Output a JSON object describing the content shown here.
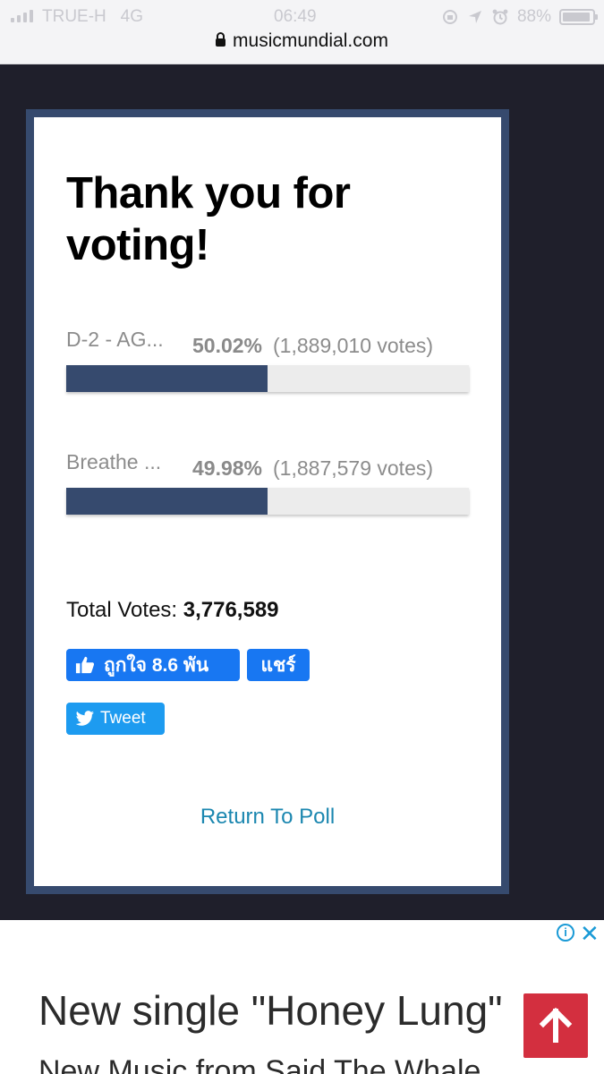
{
  "status_bar": {
    "carrier": "TRUE-H",
    "network": "4G",
    "time": "06:49",
    "battery": "88%"
  },
  "browser": {
    "url": "musicmundial.com"
  },
  "poll": {
    "title": "Thank you for voting!",
    "options": [
      {
        "name": "D-2 - AG...",
        "percent": "50.02%",
        "votes": "(1,889,010 votes)",
        "share": 0.5002
      },
      {
        "name": "Breathe ...",
        "percent": "49.98%",
        "votes": "(1,887,579 votes)",
        "share": 0.4998
      }
    ],
    "total_label": "Total Votes:",
    "total_value": "3,776,589",
    "return_link": "Return To Poll"
  },
  "social": {
    "like_label": "ถูกใจ 8.6 พัน",
    "share_label": "แชร์",
    "tweet_label": "Tweet"
  },
  "ad": {
    "headline": "New single \"Honey Lung\"",
    "subline": "New Music from Said The Whale"
  },
  "colors": {
    "accent": "#364a6e",
    "facebook": "#1877f2",
    "twitter": "#1d9bf0",
    "link": "#1b87b0",
    "scroll_button": "#d32f3f"
  }
}
